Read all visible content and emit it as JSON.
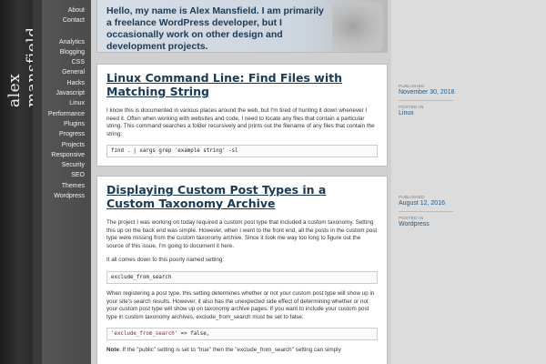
{
  "site": {
    "name": "alex mansfield",
    "tagline": "Hello, my name is Alex Mansfield. I am primarily a freelance WordPress developer, but I occasionally work on other design and development projects."
  },
  "nav": {
    "top": [
      "About",
      "Contact"
    ],
    "categories": [
      "Analytics",
      "Blogging",
      "CSS",
      "General",
      "Hacks",
      "Javascript",
      "Linux",
      "Performance",
      "Plugins",
      "Progress",
      "Projects",
      "Responsive",
      "Security",
      "SEO",
      "Themes",
      "Wordpress"
    ]
  },
  "posts": [
    {
      "title": "Linux Command Line: Find Files with Matching String",
      "paragraphs": [
        "I know this is documented in various places around the web, but I'm tired of hunting it down whenever I need it. Often when working with websites and code, I need to locate any files that contain a particular string. This command searches a folder recursively and prints out the filename of any files that contain the string:"
      ],
      "code": "find . | xargs grep 'example string' -sl",
      "published_label": "PUBLISHED",
      "published": "November 30, 2016",
      "posted_in_label": "POSTED IN",
      "posted_in": "Linux"
    },
    {
      "title": "Displaying Custom Post Types in a Custom Taxonomy Archive",
      "p1": "The project I was working on today required a custom post type that included a custom taxonomy. Setting this up on the back end was simple. However, when I went to the front end, all the posts in the custom post type were missing from the custom taxonomy archive. Since it took me way too long to figure out the source of this issue, I'm going to document it here.",
      "p2": "It all comes down to this poorly named setting:",
      "code1": "exclude_from_search",
      "p3": "When registering a post type, this setting determines whether or not your custom post type will show up in your site's search results. However, it also has the unexpected side effect of determining whether or not your custom post type will show up on taxonomy archive pages. If you want to include your custom post type in custom taxonomy archives, exclude_from_search must be set to false:",
      "code2_str": "'exclude_from_search'",
      "code2_rest": " => false,",
      "note_label": "Note",
      "note_text": ": If the \"public\" setting is set to \"true\" then the \"exclude_from_search\" setting can simply",
      "published_label": "PUBLISHED",
      "published": "August 12, 2016",
      "posted_in_label": "POSTED IN",
      "posted_in": "Wordpress"
    }
  ]
}
